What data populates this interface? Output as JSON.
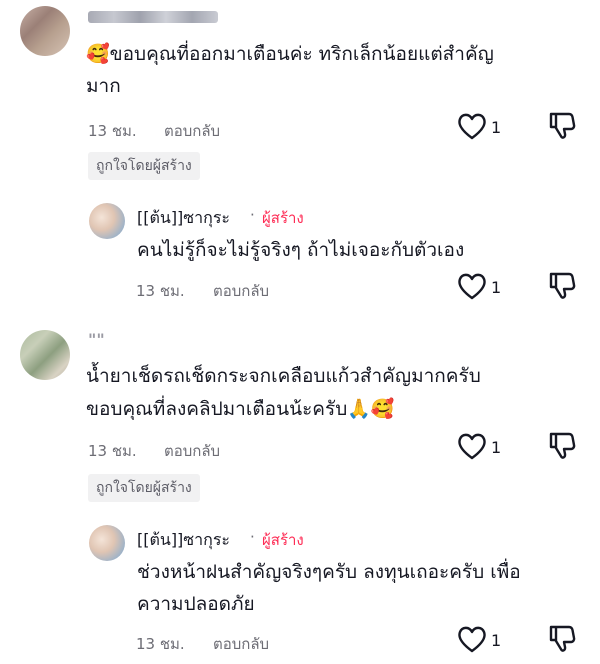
{
  "comments": [
    {
      "text": "🥰ขอบคุณที่ออกมาเตือนค่ะ ทริกเล็กน้อยแต่สำคัญ มาก",
      "line1": "🥰ขอบคุณที่ออกมาเตือนค่ะ ทริกเล็กน้อยแต่สำคัญ",
      "line2": "มาก",
      "time": "13 ชม.",
      "reply_label": "ตอบกลับ",
      "likes": "1",
      "liked_by_creator": "ถูกใจโดยผู้สร้าง",
      "reply": {
        "username": "[[ต้น]]ซากุระ",
        "separator": "·",
        "creator_label": "ผู้สร้าง",
        "text": "คนไม่รู้ก็จะไม่รู้จริงๆ ถ้าไม่เจอะกับตัวเอง",
        "time": "13 ชม.",
        "reply_label": "ตอบกลับ",
        "likes": "1"
      }
    },
    {
      "username": "\"\"",
      "text": "น้ำยาเช็ดรถเช็ดกระจกเคลือบแก้วสำคัญมากครับ ขอบคุณที่ลงคลิปมาเตือนน้ะครับ🙏🥰",
      "line1": "น้ำยาเช็ดรถเช็ดกระจกเคลือบแก้วสำคัญมากครับ",
      "line2": "ขอบคุณที่ลงคลิปมาเตือนน้ะครับ🙏🥰",
      "time": "13 ชม.",
      "reply_label": "ตอบกลับ",
      "likes": "1",
      "liked_by_creator": "ถูกใจโดยผู้สร้าง",
      "reply": {
        "username": "[[ต้น]]ซากุระ",
        "separator": "·",
        "creator_label": "ผู้สร้าง",
        "text": "ช่วงหน้าฝนสำคัญจริงๆครับ ลงทุนเถอะครับ เพื่อ ความปลอดภัย",
        "line1": "ช่วงหน้าฝนสำคัญจริงๆครับ ลงทุนเถอะครับ เพื่อ",
        "line2": "ความปลอดภัย",
        "time": "13 ชม.",
        "reply_label": "ตอบกลับ",
        "likes": "1"
      }
    }
  ],
  "icons": {
    "like": "heart-outline-icon",
    "dislike": "thumbs-down-outline-icon"
  },
  "colors": {
    "creator_accent": "#fe2c55",
    "meta_text": "#6d6d75",
    "badge_bg": "#f1f1f2"
  }
}
